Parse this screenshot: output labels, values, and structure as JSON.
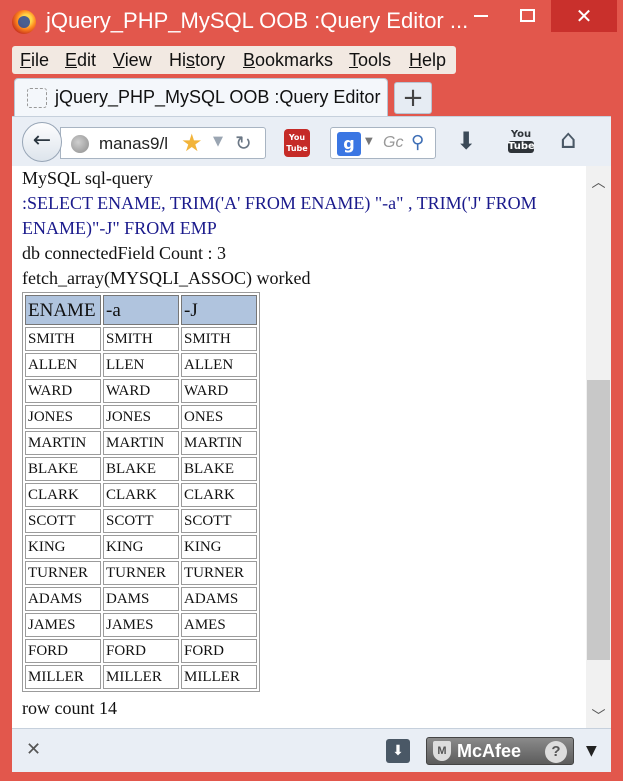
{
  "window": {
    "title": "jQuery_PHP_MySQL OOB :Query Editor ...",
    "close_glyph": "✕"
  },
  "menu": [
    {
      "key": "F",
      "rest": "ile"
    },
    {
      "key": "E",
      "rest": "dit"
    },
    {
      "key": "V",
      "rest": "iew"
    },
    {
      "pre": "Hi",
      "key": "s",
      "rest": "tory"
    },
    {
      "key": "B",
      "rest": "ookmarks"
    },
    {
      "key": "T",
      "rest": "ools"
    },
    {
      "key": "H",
      "rest": "elp"
    }
  ],
  "tab": {
    "title": "jQuery_PHP_MySQL OOB :Query Editor",
    "new_tab_label": "+"
  },
  "navbar": {
    "url": "manas9/l",
    "search_placeholder": "Gc",
    "youtube_small_label": "You Tube",
    "youtube_label_top": "You",
    "youtube_label_bottom": "Tube"
  },
  "page": {
    "heading": "MySQL sql-query",
    "query": ":SELECT ENAME, TRIM('A' FROM ENAME) \"-a\" , TRIM('J' FROM ENAME)\"-J\" FROM EMP",
    "connected_line": "db connectedField Count : 3",
    "fetch_line": "fetch_array(MYSQLI_ASSOC) worked",
    "row_count_line": "row count 14"
  },
  "table": {
    "headers": [
      "ENAME",
      "-a",
      "-J"
    ],
    "rows": [
      [
        "SMITH",
        "SMITH",
        "SMITH"
      ],
      [
        "ALLEN",
        "LLEN",
        "ALLEN"
      ],
      [
        "WARD",
        "WARD",
        "WARD"
      ],
      [
        "JONES",
        "JONES",
        "ONES"
      ],
      [
        "MARTIN",
        "MARTIN",
        "MARTIN"
      ],
      [
        "BLAKE",
        "BLAKE",
        "BLAKE"
      ],
      [
        "CLARK",
        "CLARK",
        "CLARK"
      ],
      [
        "SCOTT",
        "SCOTT",
        "SCOTT"
      ],
      [
        "KING",
        "KING",
        "KING"
      ],
      [
        "TURNER",
        "TURNER",
        "TURNER"
      ],
      [
        "ADAMS",
        "DAMS",
        "ADAMS"
      ],
      [
        "JAMES",
        "JAMES",
        "AMES"
      ],
      [
        "FORD",
        "FORD",
        "FORD"
      ],
      [
        "MILLER",
        "MILLER",
        "MILLER"
      ]
    ]
  },
  "addon": {
    "mcafee_label": "McAfee",
    "help_glyph": "?"
  },
  "colors": {
    "titlebar": "#e2574c",
    "table_header": "#b0c4de",
    "query_text": "#1a1a8c"
  },
  "icons": [
    "firefox-logo-icon",
    "back-arrow-icon",
    "globe-icon",
    "bookmark-star-icon",
    "reload-icon",
    "youtube-icon",
    "google-icon",
    "search-icon",
    "download-icon",
    "home-icon",
    "close-icon",
    "mcafee-shield-icon",
    "help-icon"
  ]
}
